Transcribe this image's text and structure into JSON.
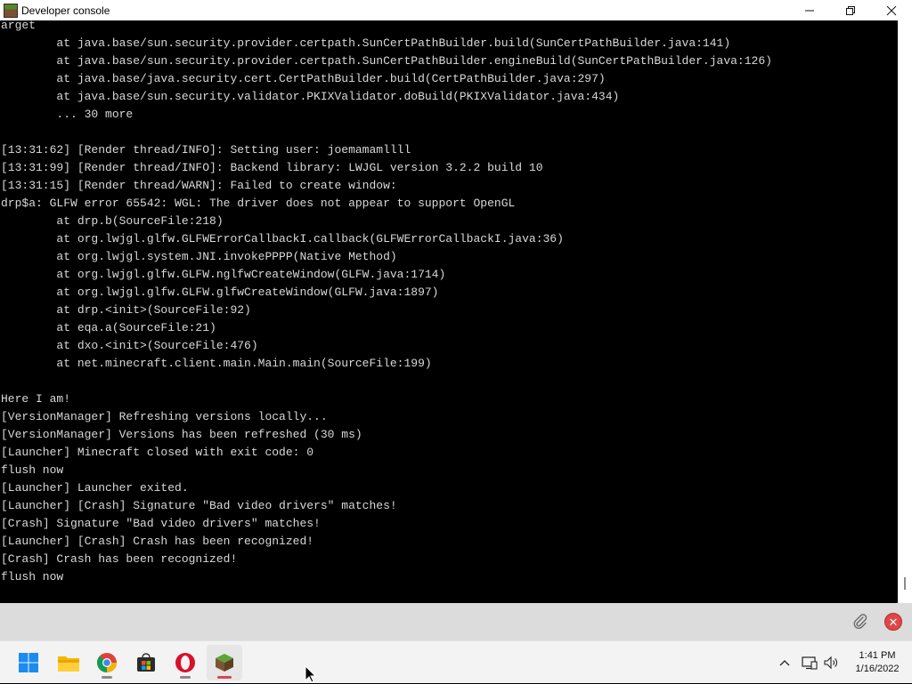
{
  "window": {
    "title": "Developer console",
    "controls": {
      "minimize": "—",
      "maximize": "❐",
      "close": "✕"
    }
  },
  "console": {
    "lines": [
      "arget",
      "        at java.base/sun.security.provider.certpath.SunCertPathBuilder.build(SunCertPathBuilder.java:141)",
      "        at java.base/sun.security.provider.certpath.SunCertPathBuilder.engineBuild(SunCertPathBuilder.java:126)",
      "        at java.base/java.security.cert.CertPathBuilder.build(CertPathBuilder.java:297)",
      "        at java.base/sun.security.validator.PKIXValidator.doBuild(PKIXValidator.java:434)",
      "        ... 30 more",
      "",
      "[13:31:62] [Render thread/INFO]: Setting user: joemamamllll",
      "[13:31:99] [Render thread/INFO]: Backend library: LWJGL version 3.2.2 build 10",
      "[13:31:15] [Render thread/WARN]: Failed to create window:",
      "drp$a: GLFW error 65542: WGL: The driver does not appear to support OpenGL",
      "        at drp.b(SourceFile:218)",
      "        at org.lwjgl.glfw.GLFWErrorCallbackI.callback(GLFWErrorCallbackI.java:36)",
      "        at org.lwjgl.system.JNI.invokePPPP(Native Method)",
      "        at org.lwjgl.glfw.GLFW.nglfwCreateWindow(GLFW.java:1714)",
      "        at org.lwjgl.glfw.GLFW.glfwCreateWindow(GLFW.java:1897)",
      "        at drp.<init>(SourceFile:92)",
      "        at eqa.a(SourceFile:21)",
      "        at dxo.<init>(SourceFile:476)",
      "        at net.minecraft.client.main.Main.main(SourceFile:199)",
      "",
      "Here I am!",
      "[VersionManager] Refreshing versions locally...",
      "[VersionManager] Versions has been refreshed (30 ms)",
      "[Launcher] Minecraft closed with exit code: 0",
      "flush now",
      "[Launcher] Launcher exited.",
      "[Launcher] [Crash] Signature \"Bad video drivers\" matches!",
      "[Crash] Signature \"Bad video drivers\" matches!",
      "[Launcher] [Crash] Crash has been recognized!",
      "[Crash] Crash has been recognized!",
      "flush now"
    ]
  },
  "input": {
    "value": "",
    "placeholder": ""
  },
  "taskbar": {
    "apps": [
      {
        "name": "start-icon"
      },
      {
        "name": "file-explorer-icon"
      },
      {
        "name": "chrome-icon"
      },
      {
        "name": "microsoft-store-icon"
      },
      {
        "name": "opera-icon"
      },
      {
        "name": "minecraft-launcher-icon",
        "active": true
      }
    ],
    "time": "1:41 PM",
    "date": "1/16/2022"
  },
  "colors": {
    "console_bg": "#000000",
    "console_text": "#d8d8d8",
    "input_bar": "#dcdcdc",
    "taskbar": "#f3f3f3",
    "close_red": "#e04646"
  }
}
